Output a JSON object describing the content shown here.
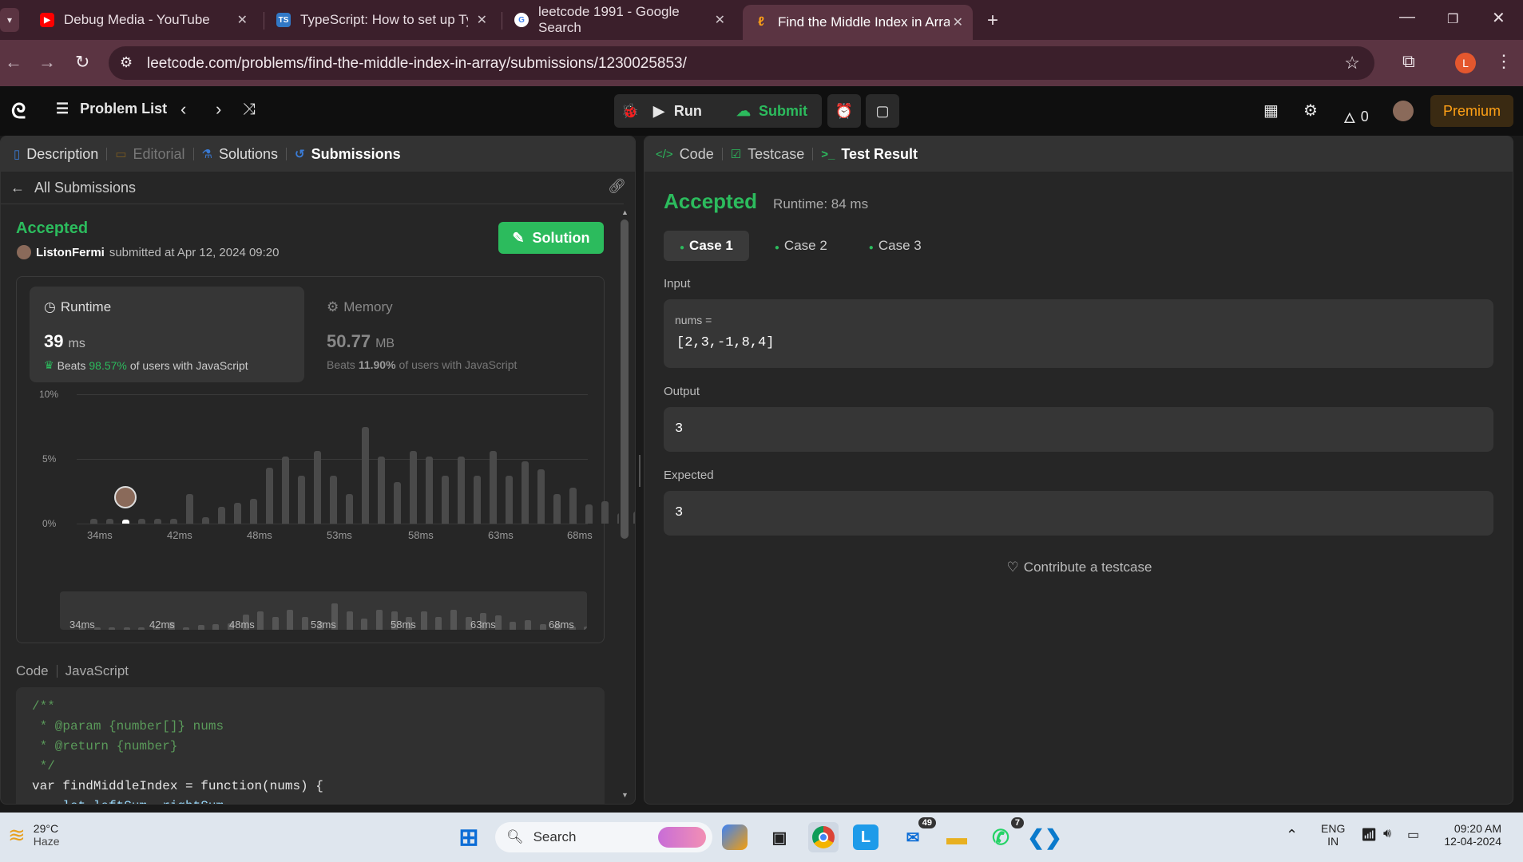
{
  "browser": {
    "tabs": [
      {
        "title": "Debug Media - YouTube"
      },
      {
        "title": "TypeScript: How to set up TypeS"
      },
      {
        "title": "leetcode 1991 - Google Search"
      },
      {
        "title": "Find the Middle Index in Array -"
      }
    ],
    "url": "leetcode.com/problems/find-the-middle-index-in-array/submissions/1230025853/",
    "profile_initial": "L"
  },
  "header": {
    "problem_list": "Problem List",
    "run": "Run",
    "submit": "Submit",
    "streak": "0",
    "premium": "Premium"
  },
  "left": {
    "tabs": [
      "Description",
      "Editorial",
      "Solutions",
      "Submissions"
    ],
    "back_label": "All Submissions",
    "status": "Accepted",
    "user": "ListonFermi",
    "submitted": "submitted at Apr 12, 2024 09:20",
    "solution_btn": "Solution",
    "runtime": {
      "label": "Runtime",
      "value": "39",
      "unit": "ms",
      "beats_prefix": "Beats",
      "beats_pct": "98.57%",
      "beats_suffix": "of users with JavaScript"
    },
    "memory": {
      "label": "Memory",
      "value": "50.77",
      "unit": "MB",
      "beats_prefix": "Beats",
      "beats_pct": "11.90%",
      "beats_suffix": "of users with JavaScript"
    },
    "code_label": "Code",
    "lang": "JavaScript"
  },
  "chart_data": {
    "type": "bar",
    "ylabels": [
      "10%",
      "5%",
      "0%"
    ],
    "ylim": [
      0,
      10
    ],
    "xlabels": [
      "34ms",
      "42ms",
      "48ms",
      "53ms",
      "58ms",
      "63ms",
      "68ms"
    ],
    "values": [
      0.4,
      0.4,
      0.3,
      0.4,
      0.4,
      0.4,
      2.3,
      0.5,
      1.3,
      1.6,
      1.9,
      4.3,
      5.2,
      3.7,
      5.6,
      3.7,
      2.3,
      7.5,
      5.2,
      3.2,
      5.6,
      5.2,
      3.7,
      5.2,
      3.7,
      5.6,
      3.7,
      4.8,
      4.2,
      2.3,
      2.8,
      1.5,
      1.7,
      0.8,
      0.9
    ],
    "highlight_index": 2
  },
  "code_lines": [
    "/**",
    " * @param {number[]} nums",
    " * @return {number}",
    " */",
    "var findMiddleIndex = function(nums) {",
    "    let leftSum, rightSum"
  ],
  "right": {
    "tabs": [
      "Code",
      "Testcase",
      "Test Result"
    ],
    "status": "Accepted",
    "runtime": "Runtime: 84 ms",
    "cases": [
      "Case 1",
      "Case 2",
      "Case 3"
    ],
    "input_label": "Input",
    "input_var": "nums =",
    "input_value": "[2,3,-1,8,4]",
    "output_label": "Output",
    "output_value": "3",
    "expected_label": "Expected",
    "expected_value": "3",
    "contribute": "Contribute a testcase"
  },
  "taskbar": {
    "temp": "29°C",
    "weather": "Haze",
    "search": "Search",
    "badge_mail": "49",
    "badge_whatsapp": "7",
    "lang1": "ENG",
    "lang2": "IN",
    "time": "09:20 AM",
    "date": "12-04-2024"
  }
}
